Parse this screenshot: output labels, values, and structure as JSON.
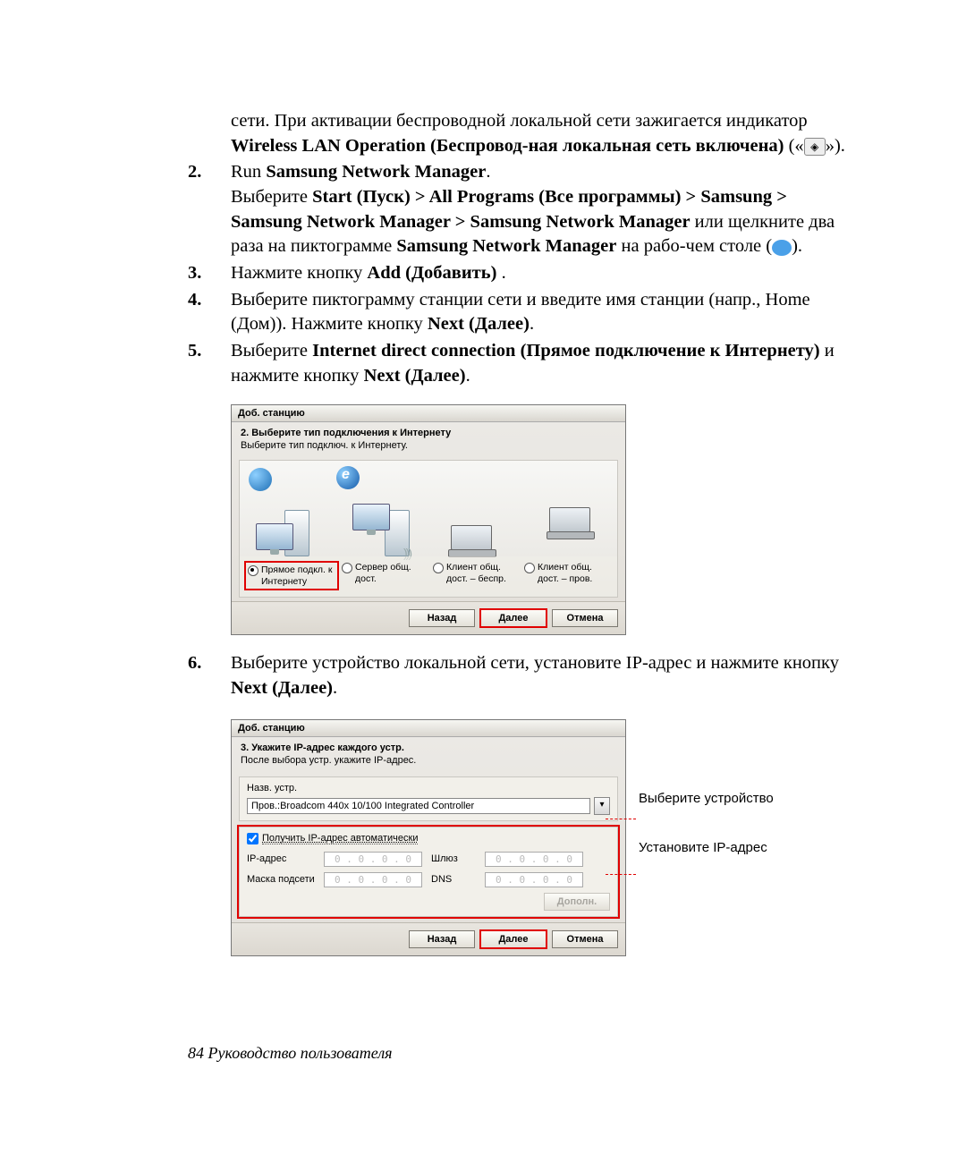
{
  "para1_a": "сети. При активации беспроводной локальной сети зажигается индикатор ",
  "para1_b": "Wireless LAN Operation (Беспровод-ная локальная сеть включена)",
  "para1_c": " («    »).",
  "s2": {
    "num": "2.",
    "a": "Run ",
    "b": "Samsung Network Manager",
    "c": ".",
    "l2a": "Выберите ",
    "l2b": "Start (Пуск) > All Programs (Все программы) > Samsung > Samsung Network Manager > Samsung Network Manager",
    "l2c": " или щелкните два раза на пиктограмме ",
    "l2d": "Samsung Network Manager",
    "l2e": " на рабо-чем столе (",
    "l2f": ")."
  },
  "s3": {
    "num": "3.",
    "a": "Нажмите кнопку ",
    "b": "Add (Добавить)",
    "c": " ."
  },
  "s4": {
    "num": "4.",
    "a": "Выберите пиктограмму станции сети и введите имя станции (напр., Home (Дом)). Нажмите кнопку  ",
    "b": "Next (Далее)",
    "c": "."
  },
  "s5": {
    "num": "5.",
    "a": "Выберите ",
    "b": "Internet direct connection (Прямое подключение к Интернету)",
    "c": " и нажмите кнопку ",
    "d": "Next (Далее)",
    "e": "."
  },
  "s6": {
    "num": "6.",
    "a": "Выберите устройство локальной сети, установите IP-адрес и нажмите кнопку ",
    "b": "Next (Далее)",
    "c": "."
  },
  "dlg1": {
    "title": "Доб. станцию",
    "head": "2. Выберите тип подключения к Интернету",
    "sub": "Выберите тип подключ. к Интернету.",
    "opt1": "Прямое подкл. к Интернету",
    "opt2": "Сервер общ. дост.",
    "opt3": "Клиент общ. дост. – беспр.",
    "opt4": "Клиент общ. дост. – пров.",
    "back": "Назад",
    "next": "Далее",
    "cancel": "Отмена"
  },
  "dlg2": {
    "title": "Доб. станцию",
    "head": "3. Укажите IP-адрес каждого устр.",
    "sub": "После выбора устр. укажите IP-адрес.",
    "devlabel": "Назв. устр.",
    "device": "Пров.:Broadcom 440x 10/100 Integrated Controller",
    "auto": "Получить IP-адрес автоматически",
    "ip": "IP-адрес",
    "mask": "Маска подсети",
    "gw": "Шлюз",
    "dns": "DNS",
    "ipval": "0  .  0  .  0  .  0",
    "extra": "Дополн.",
    "back": "Назад",
    "next": "Далее",
    "cancel": "Отмена"
  },
  "ann": {
    "dev": "Выберите устройство",
    "ip": "Установите IP-адрес"
  },
  "footer": "84  Руководство пользователя"
}
